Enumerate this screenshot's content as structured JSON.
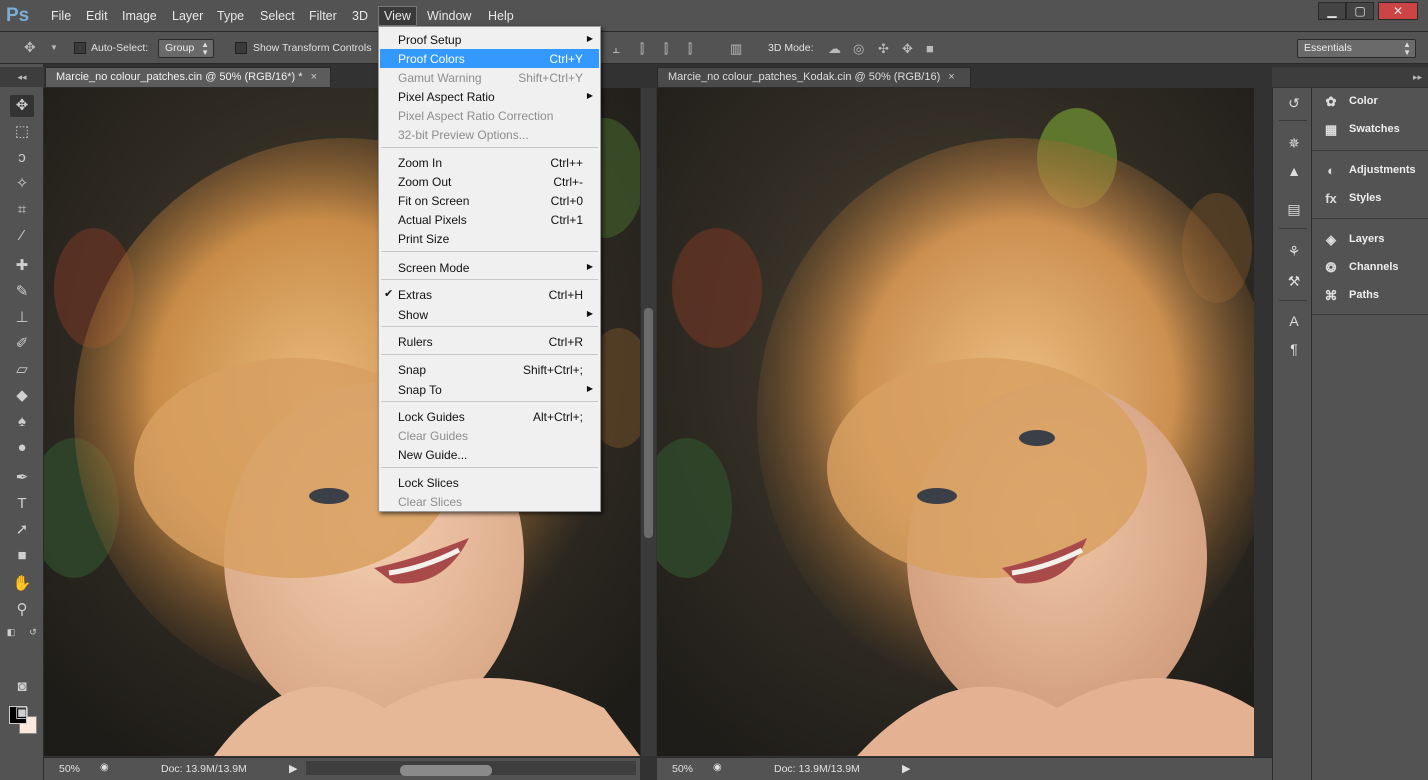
{
  "app": {
    "logo": "Ps"
  },
  "menubar": {
    "items": [
      "File",
      "Edit",
      "Image",
      "Layer",
      "Type",
      "Select",
      "Filter",
      "3D",
      "View",
      "Window",
      "Help"
    ],
    "active": "View"
  },
  "options": {
    "auto_select_label": "Auto-Select:",
    "auto_select_value": "Group",
    "show_transform_label": "Show Transform Controls",
    "mode_3d_label": "3D Mode:",
    "workspace": "Essentials"
  },
  "documents": [
    {
      "title": "Marcie_no colour_patches.cin @ 50% (RGB/16*) *",
      "zoom": "50%",
      "doc_size": "Doc: 13.9M/13.9M",
      "close": "×"
    },
    {
      "title": "Marcie_no colour_patches_Kodak.cin @ 50% (RGB/16)",
      "zoom": "50%",
      "doc_size": "Doc: 13.9M/13.9M",
      "close": "×"
    }
  ],
  "view_menu": {
    "groups": [
      [
        {
          "label": "Proof Setup",
          "submenu": true
        },
        {
          "label": "Proof Colors",
          "shortcut": "Ctrl+Y",
          "highlighted": true
        },
        {
          "label": "Gamut Warning",
          "shortcut": "Shift+Ctrl+Y",
          "disabled": true
        },
        {
          "label": "Pixel Aspect Ratio",
          "submenu": true
        },
        {
          "label": "Pixel Aspect Ratio Correction",
          "disabled": true
        },
        {
          "label": "32-bit Preview Options...",
          "disabled": true
        }
      ],
      [
        {
          "label": "Zoom In",
          "shortcut": "Ctrl++"
        },
        {
          "label": "Zoom Out",
          "shortcut": "Ctrl+-"
        },
        {
          "label": "Fit on Screen",
          "shortcut": "Ctrl+0"
        },
        {
          "label": "Actual Pixels",
          "shortcut": "Ctrl+1"
        },
        {
          "label": "Print Size"
        }
      ],
      [
        {
          "label": "Screen Mode",
          "submenu": true
        }
      ],
      [
        {
          "label": "Extras",
          "shortcut": "Ctrl+H",
          "checked": true
        },
        {
          "label": "Show",
          "submenu": true
        }
      ],
      [
        {
          "label": "Rulers",
          "shortcut": "Ctrl+R"
        }
      ],
      [
        {
          "label": "Snap",
          "shortcut": "Shift+Ctrl+;"
        },
        {
          "label": "Snap To",
          "submenu": true
        }
      ],
      [
        {
          "label": "Lock Guides",
          "shortcut": "Alt+Ctrl+;"
        },
        {
          "label": "Clear Guides",
          "disabled": true
        },
        {
          "label": "New Guide..."
        }
      ],
      [
        {
          "label": "Lock Slices"
        },
        {
          "label": "Clear Slices",
          "disabled": true
        }
      ]
    ]
  },
  "panels": {
    "groups": [
      [
        "Color",
        "Swatches"
      ],
      [
        "Adjustments",
        "Styles"
      ],
      [
        "Layers",
        "Channels",
        "Paths"
      ]
    ]
  },
  "tools": [
    "move-tool",
    "marquee-tool",
    "lasso-tool",
    "quick-select-tool",
    "crop-tool",
    "eyedropper-tool",
    "healing-brush-tool",
    "brush-tool",
    "clone-stamp-tool",
    "history-brush-tool",
    "eraser-tool",
    "paint-bucket-tool",
    "blur-tool",
    "dodge-tool",
    "pen-tool",
    "type-tool",
    "path-select-tool",
    "rectangle-tool",
    "hand-tool",
    "zoom-tool"
  ],
  "colors": {
    "foreground": "#000000",
    "background": "#fbe8dc",
    "highlight": "#3399ff"
  }
}
